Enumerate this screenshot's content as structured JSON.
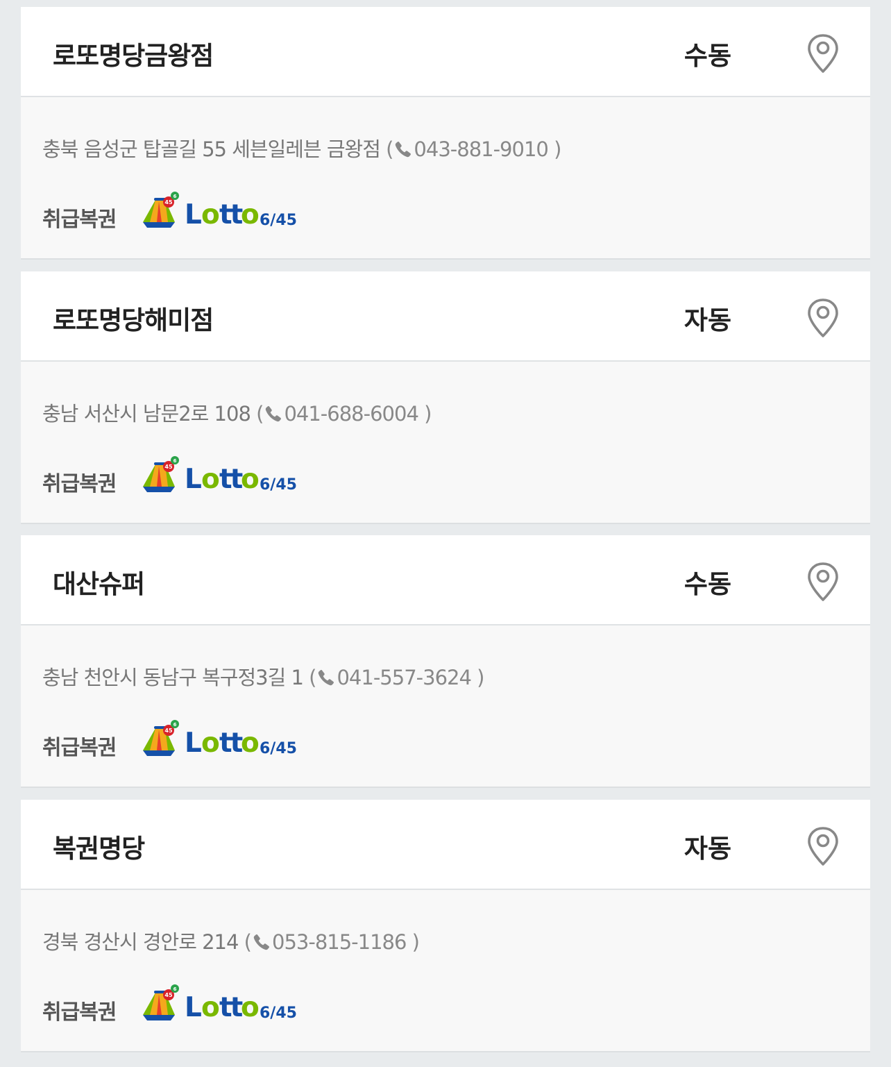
{
  "label_lottery_types": "취급복권",
  "stores": [
    {
      "name": "로또명당금왕점",
      "method": "수동",
      "address": "충북 음성군 탑골길 55 세븐일레븐 금왕점",
      "phone": "043-881-9010",
      "map_icon": "map-pin-icon",
      "lottery_logo_text": "Lotto6/45"
    },
    {
      "name": "로또명당해미점",
      "method": "자동",
      "address": "충남 서산시 남문2로 108",
      "phone": "041-688-6004",
      "map_icon": "map-pin-icon",
      "lottery_logo_text": "Lotto6/45"
    },
    {
      "name": "대산슈퍼",
      "method": "수동",
      "address": "충남 천안시 동남구 복구정3길 1",
      "phone": "041-557-3624",
      "map_icon": "map-pin-icon",
      "lottery_logo_text": "Lotto6/45"
    },
    {
      "name": "복권명당",
      "method": "자동",
      "address": "경북 경산시 경안로 214",
      "phone": "053-815-1186",
      "map_icon": "map-pin-icon",
      "lottery_logo_text": "Lotto6/45"
    }
  ],
  "colors": {
    "page_bg": "#e8ebed",
    "card_header_bg": "#ffffff",
    "card_body_bg": "#f8f8f8",
    "lotto_blue": "#1550a8",
    "lotto_green": "#7ab800"
  }
}
